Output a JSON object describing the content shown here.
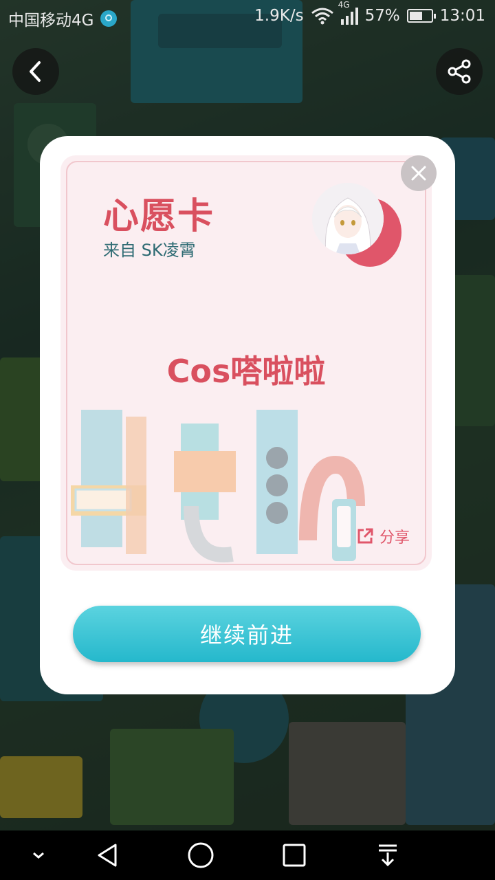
{
  "status_bar": {
    "carrier": "中国移动4G",
    "speed": "1.9K/s",
    "network": "4G",
    "battery": "57%",
    "time": "13:01"
  },
  "icons": {
    "back": "chevron-left-icon",
    "share_top": "share-icon",
    "close": "close-icon",
    "share_link": "external-link-icon"
  },
  "card": {
    "title": "心愿卡",
    "from": "来自 SK凌霄",
    "wish": "Cos嗒啦啦",
    "share_label": "分享"
  },
  "continue_button": {
    "label": "继续前进"
  },
  "colors": {
    "accent_pink": "#d9505f",
    "button_cyan": "#25b8cc",
    "card_bg": "#fbeef1"
  }
}
